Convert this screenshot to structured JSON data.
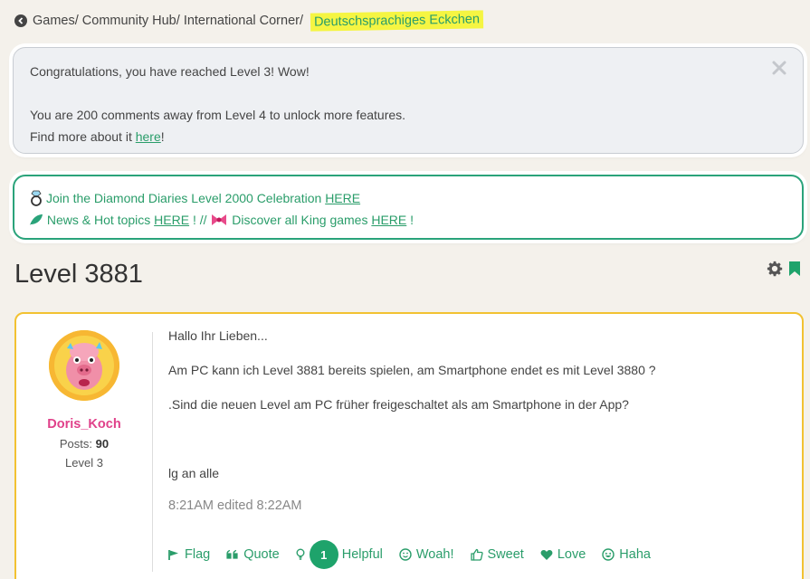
{
  "breadcrumb": {
    "items": [
      "Games/ ",
      "Community Hub/ ",
      "International Corner/ "
    ],
    "current": "Deutschsprachiges Eckchen"
  },
  "notice": {
    "line1": "Congratulations, you have reached Level 3! Wow!",
    "line2": "You are 200 comments away from Level 4 to unlock more features.",
    "line3_prefix": "Find more about it ",
    "line3_link": "here",
    "line3_suffix": "!"
  },
  "promo": {
    "line1_text": "Join the Diamond Diaries Level 2000 Celebration ",
    "line1_link": "HERE",
    "line2_text1": " News & Hot topics ",
    "line2_link1": "HERE",
    "line2_text2": " ! // ",
    "line2_text3": " Discover all King games ",
    "line2_link2": "HERE",
    "line2_text4": " !"
  },
  "topic": {
    "title": "Level 3881"
  },
  "post": {
    "author": {
      "name": "Doris_Koch",
      "posts_label": "Posts: ",
      "posts_count": "90",
      "level": "Level 3"
    },
    "body": [
      "Hallo Ihr Lieben...",
      "Am PC kann ich Level 3881 bereits spielen, am Smartphone endet es mit Level 3880 ?",
      ".Sind die neuen Level am PC früher freigeschaltet als am Smartphone in der App?",
      "lg an alle"
    ],
    "timestamp": "8:21AM edited 8:22AM",
    "actions": {
      "flag": "Flag",
      "quote": "Quote",
      "helpful_count": "1",
      "helpful": "Helpful",
      "woah": "Woah!",
      "sweet": "Sweet",
      "love": "Love",
      "haha": "Haha"
    }
  },
  "colors": {
    "accent": "#2a9d6a",
    "username": "#e0418a",
    "post_border": "#f2c232",
    "highlight": "#f5f542"
  }
}
